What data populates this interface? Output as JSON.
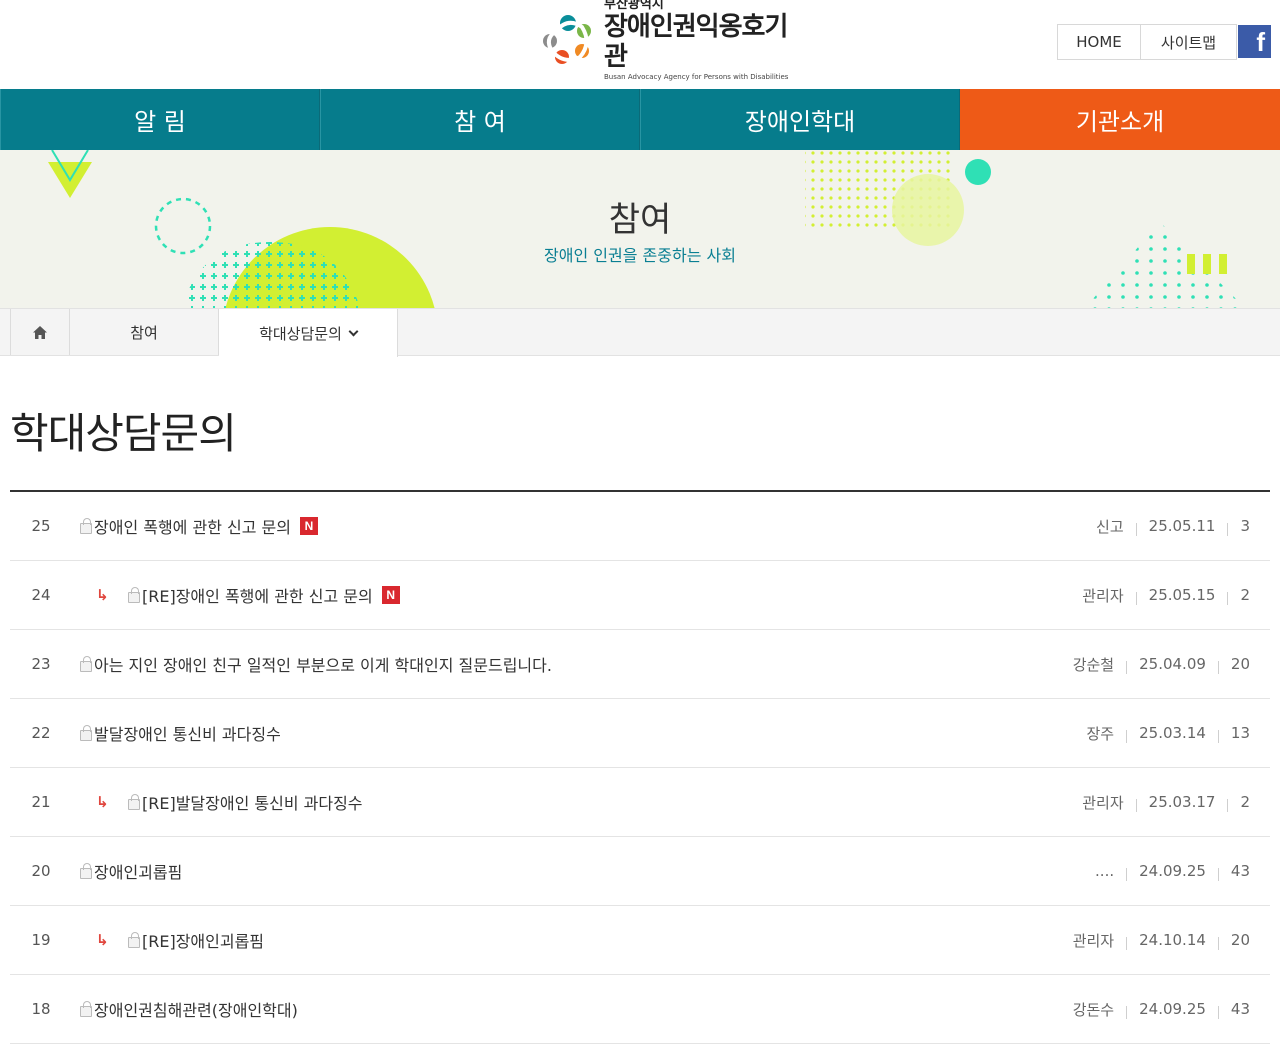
{
  "header": {
    "logo_sub": "부산광역시",
    "logo_main": "장애인권익옹호기관",
    "logo_en": "Busan Advocacy Agency for Persons with Disabilities",
    "home_label": "HOME",
    "sitemap_label": "사이트맵",
    "facebook_label": "f"
  },
  "nav": {
    "items": [
      {
        "label": "알 림"
      },
      {
        "label": "참 여"
      },
      {
        "label": "장애인학대"
      },
      {
        "label": "기관소개"
      }
    ]
  },
  "banner": {
    "title": "참여",
    "subtitle": "장애인 인권을 존중하는 사회"
  },
  "breadcrumb": {
    "level1": "참여",
    "level2": "학대상담문의"
  },
  "page": {
    "title": "학대상담문의"
  },
  "board": {
    "new_badge": "N",
    "reply_mark": "↳",
    "rows": [
      {
        "num": "25",
        "subject": "장애인 폭행에 관한 신고 문의",
        "author": "신고",
        "date": "25.05.11",
        "views": "3"
      },
      {
        "num": "24",
        "subject": "[RE]장애인 폭행에 관한 신고 문의",
        "author": "관리자",
        "date": "25.05.15",
        "views": "2"
      },
      {
        "num": "23",
        "subject": "아는 지인 장애인 친구 일적인 부분으로 이게 학대인지 질문드립니다.",
        "author": "강순철",
        "date": "25.04.09",
        "views": "20"
      },
      {
        "num": "22",
        "subject": "발달장애인 통신비 과다징수",
        "author": "장주",
        "date": "25.03.14",
        "views": "13"
      },
      {
        "num": "21",
        "subject": "[RE]발달장애인 통신비 과다징수",
        "author": "관리자",
        "date": "25.03.17",
        "views": "2"
      },
      {
        "num": "20",
        "subject": "장애인괴롭핌",
        "author": "....",
        "date": "24.09.25",
        "views": "43"
      },
      {
        "num": "19",
        "subject": "[RE]장애인괴롭핌",
        "author": "관리자",
        "date": "24.10.14",
        "views": "20"
      },
      {
        "num": "18",
        "subject": "장애인권침해관련(장애인학대)",
        "author": "강돈수",
        "date": "24.09.25",
        "views": "43"
      }
    ]
  },
  "colors": {
    "nav_bg": "#067c8c",
    "nav_active": "#ee5a17",
    "banner_bg": "#f2f3ec",
    "accent_teal": "#0a7f93",
    "lime": "#d2ef32",
    "mint": "#2fe0b5",
    "new_badge": "#d9282e"
  }
}
